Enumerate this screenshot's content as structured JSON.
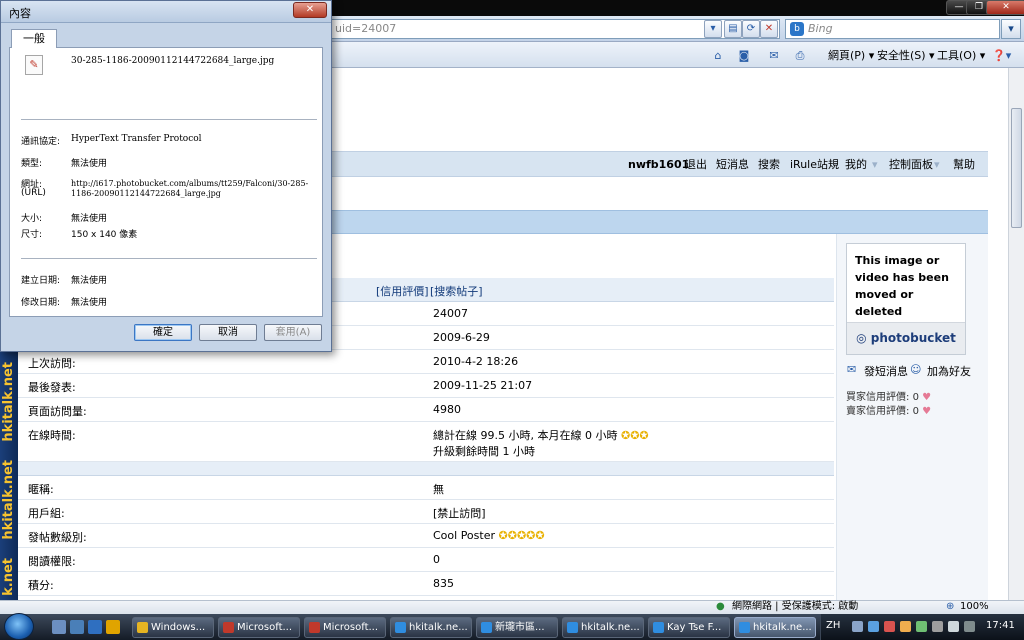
{
  "browser": {
    "address_fragment": "uid=24007",
    "search_placeholder": "Bing",
    "search_go": "▾",
    "commands": {
      "page": "網頁(P) ▾",
      "safety": "安全性(S) ▾",
      "tools": "工具(O) ▾",
      "help": "❓▾"
    }
  },
  "forum": {
    "logo_text": [
      "hkitalk.net",
      "hkitalk.net",
      "k.net"
    ],
    "nav": {
      "username": "nwfb1601",
      "items": [
        "退出",
        "短消息",
        "搜索",
        "iRule站規",
        "我的",
        "控制面板",
        "幫助"
      ]
    },
    "links_row": [
      "[信用評價]",
      "[搜索帖子]"
    ],
    "rows_top": [
      {
        "label": "",
        "value": "24007"
      },
      {
        "label": "",
        "value": "2009-6-29"
      },
      {
        "label": "上次訪問:",
        "value": "2010-4-2 18:26"
      },
      {
        "label": "最後發表:",
        "value": "2009-11-25 21:07"
      },
      {
        "label": "頁面訪問量:",
        "value": "4980"
      }
    ],
    "online_row": {
      "label": "在線時間:",
      "value_line1": "總計在線 99.5 小時, 本月在線 0 小時",
      "value_line2": "升級剩餘時間 1 小時"
    },
    "rows_bottom": [
      {
        "label": "暱稱:",
        "value": "無"
      },
      {
        "label": "用戶組:",
        "value": "[禁止訪問]"
      },
      {
        "label": "發帖數級別:",
        "value": "Cool Poster"
      },
      {
        "label": "閱讀權限:",
        "value": "0"
      },
      {
        "label": "積分:",
        "value": "835"
      }
    ],
    "photobucket": {
      "message": "This image or video has been moved or deleted",
      "brand": "photobucket"
    },
    "side_actions": [
      "發短消息",
      "加為好友"
    ],
    "ratings": [
      {
        "label": "買家信用評價:",
        "value": "0"
      },
      {
        "label": "賣家信用評價:",
        "value": "0"
      }
    ]
  },
  "dialog": {
    "title": "內容",
    "close": "✕",
    "tab": "一般",
    "filename": "30-285-1186-20090112144722684_large.jpg",
    "props": {
      "protocol_label": "通訊協定:",
      "protocol_value": "HyperText Transfer Protocol",
      "type_label": "類型:",
      "type_value": "無法使用",
      "address_label_1": "網址:",
      "address_label_2": "(URL)",
      "address_value_1": "http://i617.photobucket.com/albums/tt259/Falconi/30-285-",
      "address_value_2": "1186-20090112144722684_large.jpg",
      "size_label": "大小:",
      "size_value": "無法使用",
      "dimensions_label": "尺寸:",
      "dimensions_value": "150 x 140 像素",
      "created_label": "建立日期:",
      "created_value": "無法使用",
      "modified_label": "修改日期:",
      "modified_value": "無法使用"
    },
    "buttons": {
      "ok": "確定",
      "cancel": "取消",
      "apply": "套用(A)"
    }
  },
  "statusbar": {
    "zone": "網際網路 | 受保護模式: 啟動",
    "zoom": "100%"
  },
  "taskbar": {
    "tasks": [
      "Windows...",
      "Microsoft...",
      "Microsoft...",
      "hkitalk.ne...",
      "新瓏市區...",
      "hkitalk.ne...",
      "Kay Tse F...",
      "hkitalk.ne..."
    ],
    "lang": "ZH",
    "clock": "17:41"
  }
}
